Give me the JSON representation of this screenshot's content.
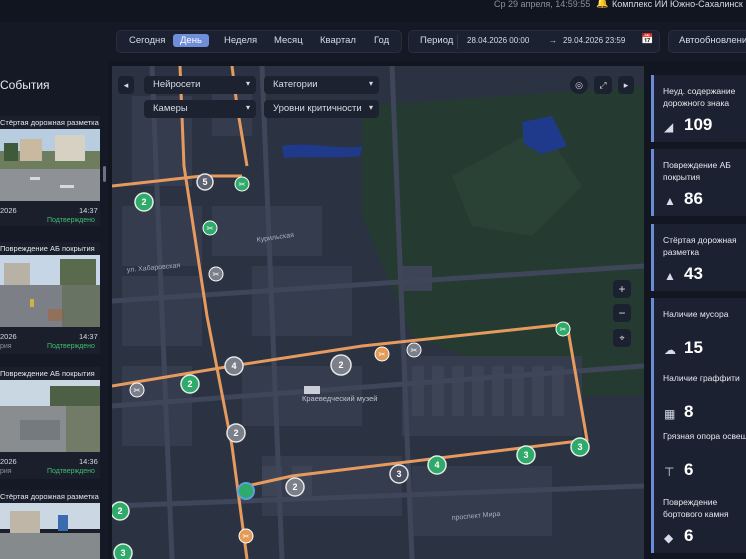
{
  "topbar": {
    "datetime": "Ср 29 апреля, 14:59:55",
    "org": "Комплекс ИИ Южно-Сахалинск"
  },
  "filters": {
    "periods": [
      "Сегодня",
      "День",
      "Неделя",
      "Месяц",
      "Квартал",
      "Год"
    ],
    "active_period": "День",
    "period_label": "Период",
    "date_from": "28.04.2026 00:00",
    "arrow": "→",
    "date_to": "29.04.2026 23:59",
    "auto_update": "Автообновление"
  },
  "events": {
    "title": "События",
    "items": [
      {
        "title": "Стёртая дорожная разметка",
        "date": "2026",
        "time": "14:37",
        "category": "",
        "status": "Подтверждено"
      },
      {
        "title": "Повреждение АБ покрытия",
        "date": "2026",
        "time": "14:37",
        "category": "рия",
        "status": "Подтверждено"
      },
      {
        "title": "Повреждение АБ покрытия",
        "date": "2026",
        "time": "14:36",
        "category": "рия",
        "status": "Подтверждено"
      },
      {
        "title": "Стёртая дорожная разметка",
        "date": "",
        "time": "",
        "category": "",
        "status": ""
      }
    ]
  },
  "map": {
    "dropdowns": {
      "networks": "Нейросети",
      "categories": "Категории",
      "cameras": "Камеры",
      "levels": "Уровни критичности"
    },
    "labels": {
      "museum": "Краеведческий музей",
      "street1": "Курильская",
      "street2": "ул. Хабаровская",
      "street3": "проспект Мира"
    },
    "clusters": [
      "5",
      "2",
      "2",
      "2",
      "2",
      "3",
      "3",
      "4",
      "3",
      "2",
      "3",
      "2",
      "3",
      "4",
      "8"
    ],
    "zoom_in": "+",
    "zoom_out": "−"
  },
  "stats": [
    {
      "label": "Неуд. содержание дорожного знака",
      "value": "109",
      "icon": "sign-icon"
    },
    {
      "label": "Повреждение АБ покрытия",
      "value": "86",
      "icon": "pothole-icon"
    },
    {
      "label": "Стёртая дорожная разметка",
      "value": "43",
      "icon": "marking-icon"
    },
    {
      "label": "Наличие мусора",
      "value": "15",
      "icon": "trash-icon"
    },
    {
      "label": "Наличие граффити",
      "value": "8",
      "icon": "graffiti-icon"
    },
    {
      "label": "Грязная опора освещ",
      "value": "6",
      "icon": "lamp-icon"
    },
    {
      "label": "Повреждение бортового камня",
      "value": "6",
      "icon": "curb-icon"
    }
  ],
  "colors": {
    "accent": "#6f8dd8",
    "route": "#f0a060",
    "confirmed": "#3fbf72",
    "cluster_green": "#2faa6a",
    "cluster_grey": "#7a7f8a"
  }
}
